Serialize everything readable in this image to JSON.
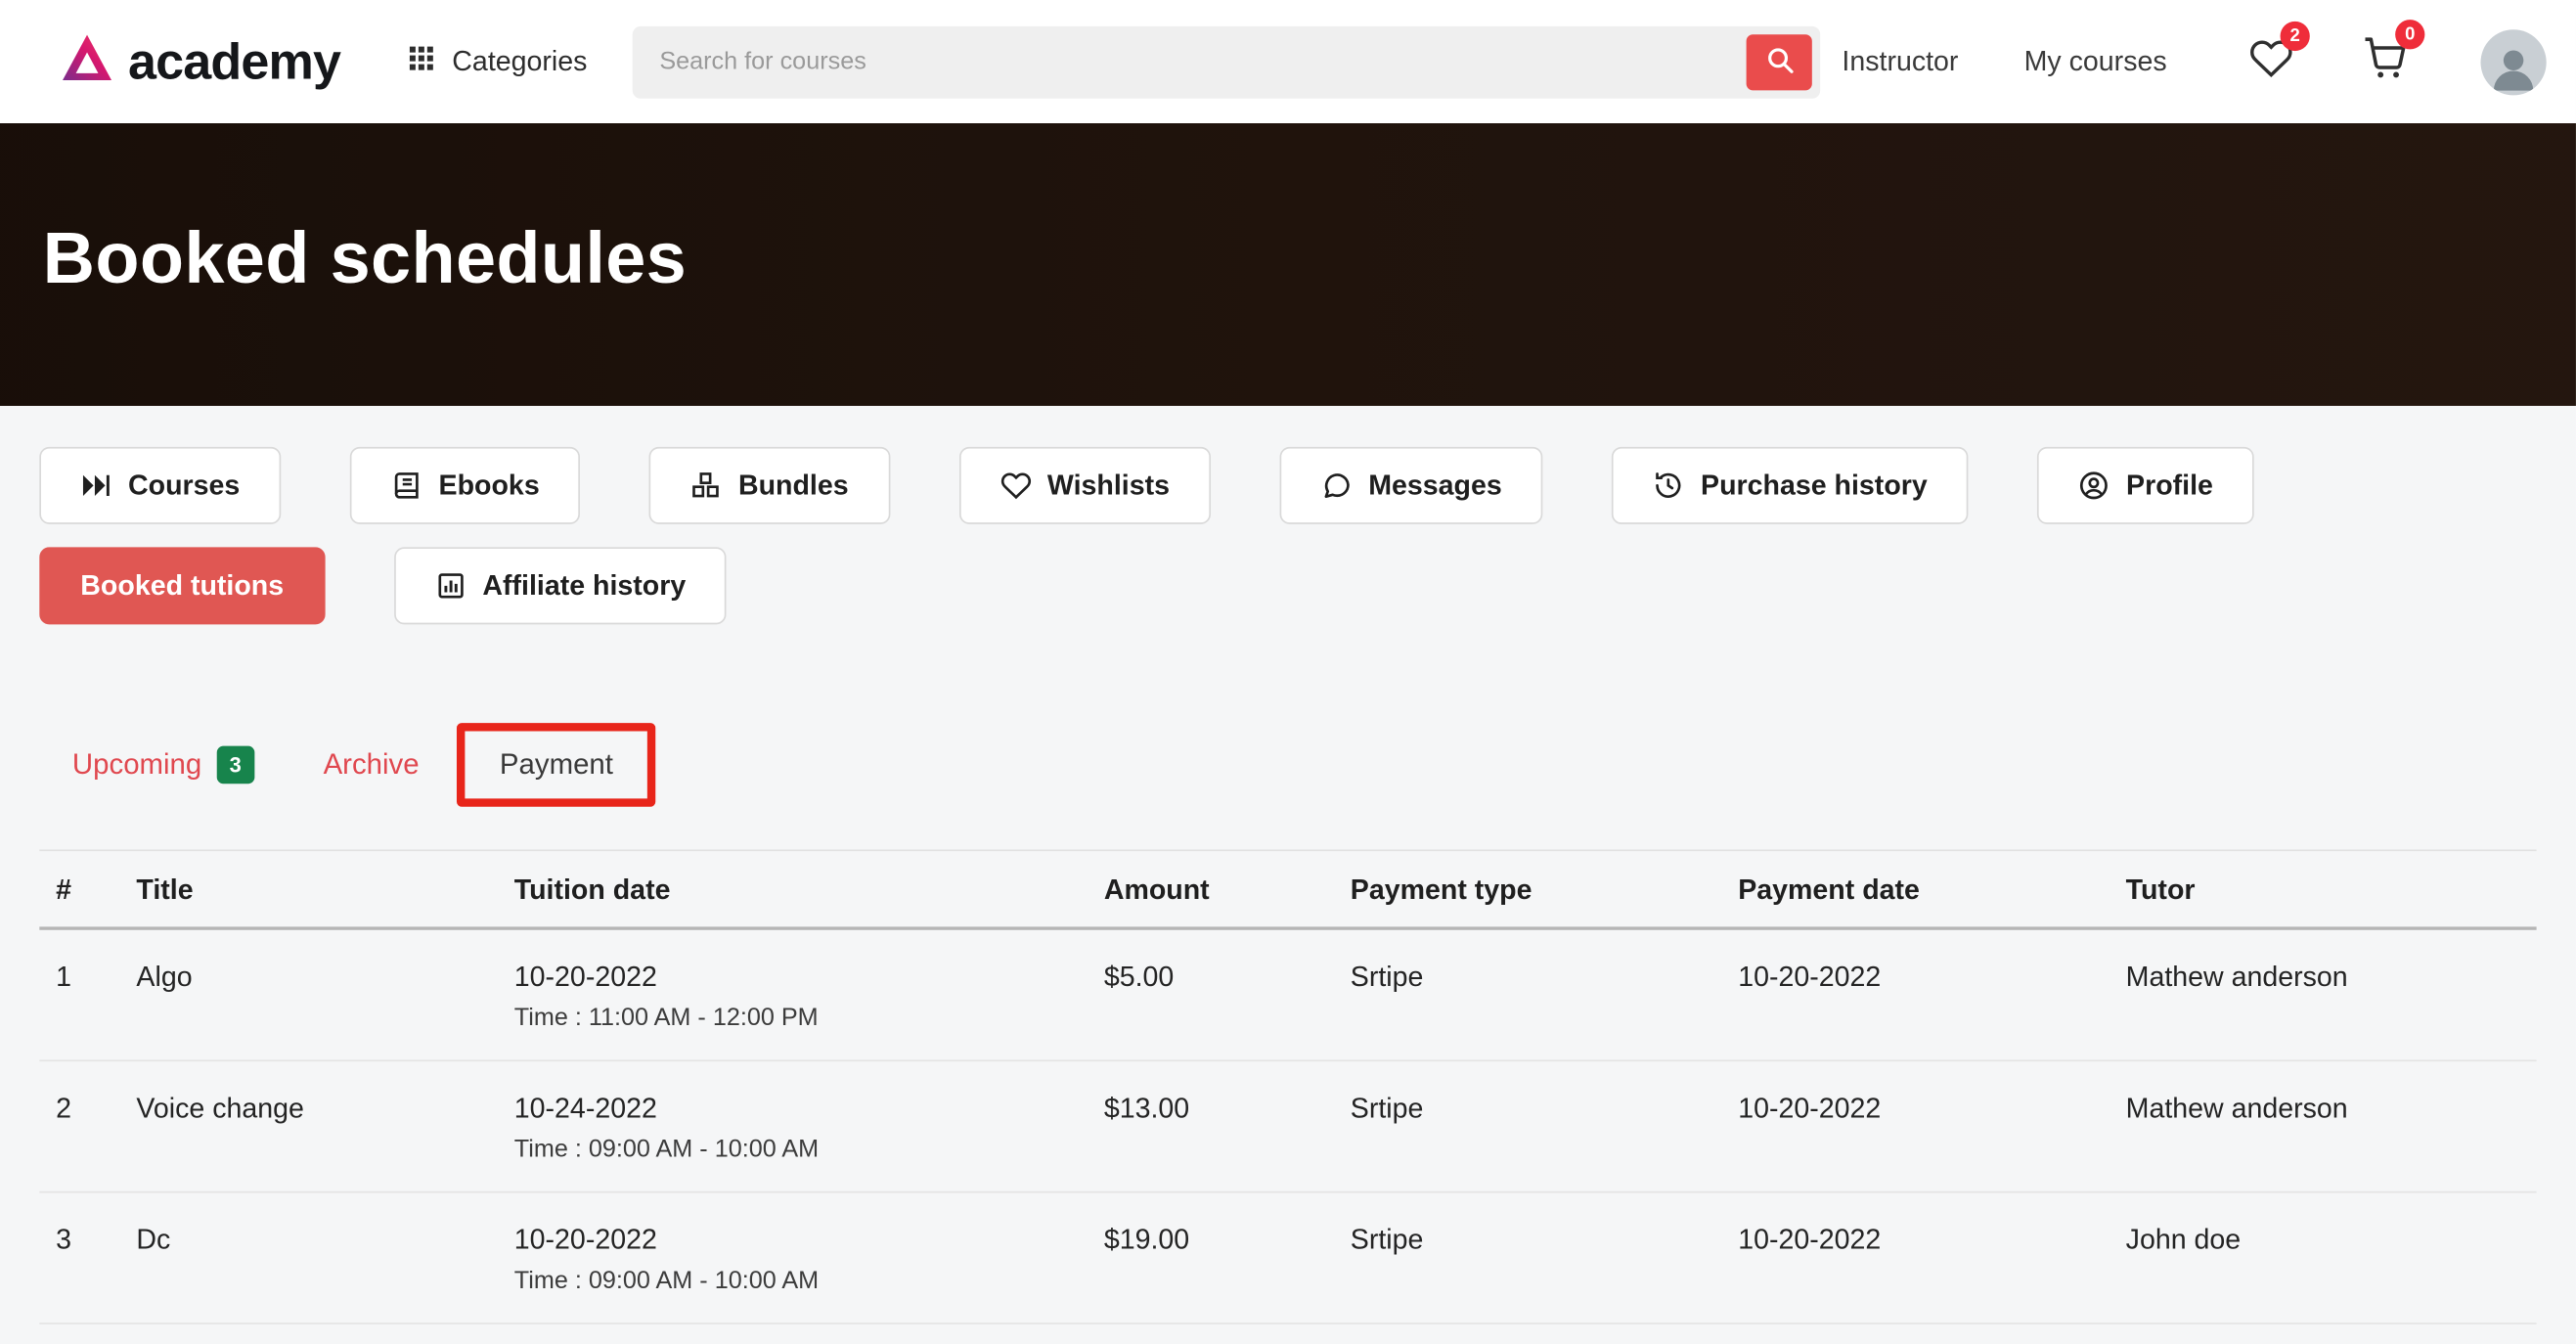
{
  "header": {
    "logo": "academy",
    "categories": "Categories",
    "search_placeholder": "Search for courses",
    "instructor": "Instructor",
    "my_courses": "My courses",
    "wishlist_count": "2",
    "cart_count": "0"
  },
  "banner": {
    "title": "Booked schedules"
  },
  "menu": {
    "items": [
      {
        "label": "Courses"
      },
      {
        "label": "Ebooks"
      },
      {
        "label": "Bundles"
      },
      {
        "label": "Wishlists"
      },
      {
        "label": "Messages"
      },
      {
        "label": "Purchase history"
      },
      {
        "label": "Profile"
      },
      {
        "label": "Booked tutions",
        "active": true
      },
      {
        "label": "Affiliate history"
      }
    ]
  },
  "tabs": {
    "upcoming": "Upcoming",
    "upcoming_badge": "3",
    "archive": "Archive",
    "payment": "Payment"
  },
  "table": {
    "headers": {
      "num": "#",
      "title": "Title",
      "tuition_date": "Tuition date",
      "amount": "Amount",
      "payment_type": "Payment type",
      "payment_date": "Payment date",
      "tutor": "Tutor"
    },
    "rows": [
      {
        "num": "1",
        "title": "Algo",
        "tuition_date": "10-20-2022",
        "tuition_time": "Time : 11:00 AM - 12:00 PM",
        "amount": "$5.00",
        "payment_type": "Srtipe",
        "payment_date": "10-20-2022",
        "tutor": "Mathew anderson"
      },
      {
        "num": "2",
        "title": "Voice change",
        "tuition_date": "10-24-2022",
        "tuition_time": "Time : 09:00 AM - 10:00 AM",
        "amount": "$13.00",
        "payment_type": "Srtipe",
        "payment_date": "10-20-2022",
        "tutor": "Mathew anderson"
      },
      {
        "num": "3",
        "title": "Dc",
        "tuition_date": "10-20-2022",
        "tuition_time": "Time : 09:00 AM - 10:00 AM",
        "amount": "$19.00",
        "payment_type": "Srtipe",
        "payment_date": "10-20-2022",
        "tutor": "John doe"
      }
    ]
  },
  "icons": {
    "logo-mark-icon": "stylized-A-triangle",
    "grid-icon": "3x3-grid",
    "search-icon": "magnifier",
    "heart-icon": "heart-outline",
    "cart-icon": "shopping-cart",
    "avatar": "person-silhouette",
    "courses-icon": "skip-forward",
    "ebooks-icon": "book",
    "bundles-icon": "packages",
    "wishlists-icon": "heart-outline",
    "messages-icon": "chat-bubble",
    "purchase-history-icon": "clock-history",
    "profile-icon": "user-circle",
    "affiliate-history-icon": "bar-chart-box"
  },
  "colors": {
    "accent_red": "#ea4c4c",
    "active_button": "#e05753",
    "tab_link_red": "#e0484f",
    "badge_green": "#17844c",
    "annotation_red": "#e8251a",
    "banner_text": "#ffffff"
  }
}
